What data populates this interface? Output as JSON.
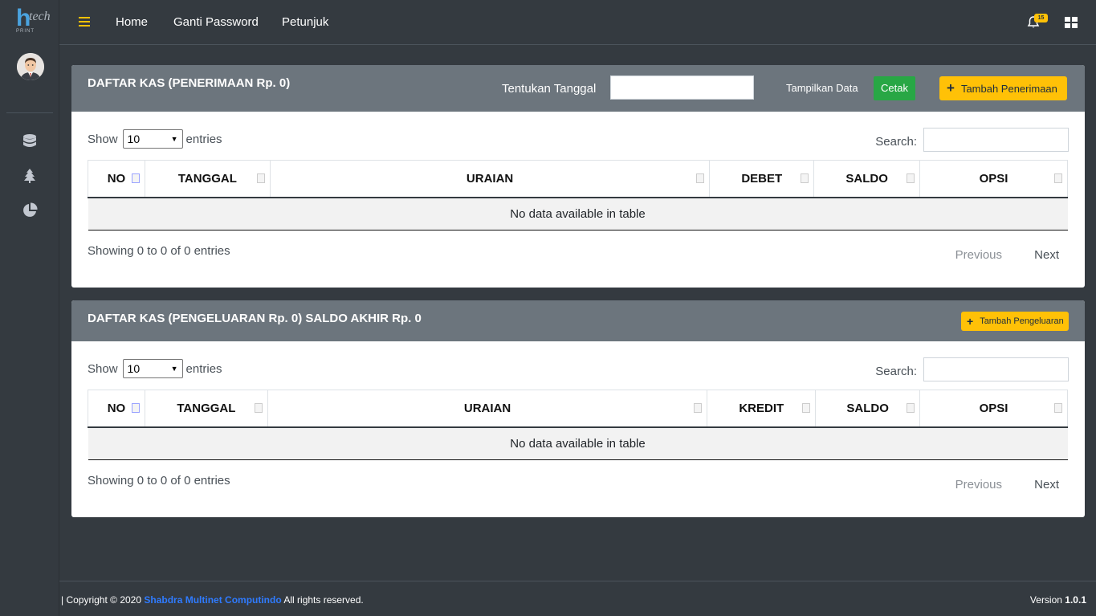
{
  "logo": {
    "letter": "h",
    "script": "tech",
    "sub": "PRINT"
  },
  "icons": {
    "menu": "hamburger-icon",
    "notifications": "bell-icon",
    "apps": "grid-icon",
    "sidebar": [
      "database-icon",
      "tree-icon",
      "pie-chart-icon"
    ]
  },
  "colors": {
    "accent": "#ffc107",
    "header": "#6c757d",
    "success": "#28a745",
    "brand_link": "#2f7bff",
    "bg": "#343a40"
  },
  "nav": {
    "home": "Home",
    "ganti_password": "Ganti Password",
    "petunjuk": "Petunjuk"
  },
  "notifications": {
    "count": "15"
  },
  "penerimaan": {
    "title": "DAFTAR KAS (PENERIMAAN Rp. 0)",
    "date_label": "Tentukan Tanggal",
    "date_value": "",
    "tampilkan": "Tampilkan Data",
    "cetak": "Cetak",
    "tambah": "Tambah Penerimaan",
    "show": "Show",
    "entries_value": "10",
    "entries": "entries",
    "search": "Search:",
    "columns": [
      "NO",
      "TANGGAL",
      "URAIAN",
      "DEBET",
      "SALDO",
      "OPSI"
    ],
    "empty": "No data available in table",
    "info": "Showing 0 to 0 of 0 entries",
    "previous": "Previous",
    "next": "Next"
  },
  "pengeluaran": {
    "title": "DAFTAR KAS (PENGELUARAN Rp. 0) SALDO AKHIR Rp. 0",
    "tambah": "Tambah Pengeluaran",
    "show": "Show",
    "entries_value": "10",
    "entries": "entries",
    "search": "Search:",
    "columns": [
      "NO",
      "TANGGAL",
      "URAIAN",
      "KREDIT",
      "SALDO",
      "OPSI"
    ],
    "empty": "No data available in table",
    "info": "Showing 0 to 0 of 0 entries",
    "previous": "Previous",
    "next": "Next"
  },
  "footer": {
    "copyright": "| Copyright © 2020",
    "company": "Shabdra Multinet Computindo",
    "rights": "All rights reserved.",
    "version_label": "Version",
    "version": "1.0.1"
  }
}
